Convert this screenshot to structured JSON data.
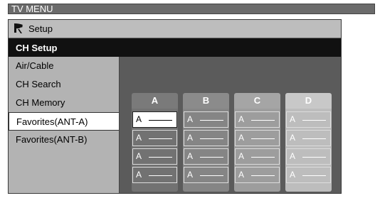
{
  "window_title": "TV MENU",
  "setup": {
    "label": "Setup",
    "icon": "satellite-dish-icon"
  },
  "section_title": "CH Setup",
  "sidebar": {
    "items": [
      {
        "label": "Air/Cable",
        "selected": false
      },
      {
        "label": "CH Search",
        "selected": false
      },
      {
        "label": "CH Memory",
        "selected": false
      },
      {
        "label": "Favorites(ANT-A)",
        "selected": true
      },
      {
        "label": "Favorites(ANT-B)",
        "selected": false
      }
    ]
  },
  "favorites": {
    "columns": [
      {
        "label": "A",
        "head_color": "#7a7a7a",
        "body_color": "#727272"
      },
      {
        "label": "B",
        "head_color": "#8b8b8b",
        "body_color": "#858585"
      },
      {
        "label": "C",
        "head_color": "#a5a5a5",
        "body_color": "#9d9d9d"
      },
      {
        "label": "D",
        "head_color": "#c8c8c8",
        "body_color": "#bdbdbd"
      }
    ],
    "slot_label": "A",
    "rows": 4,
    "selected": {
      "column": 0,
      "row": 0
    }
  }
}
